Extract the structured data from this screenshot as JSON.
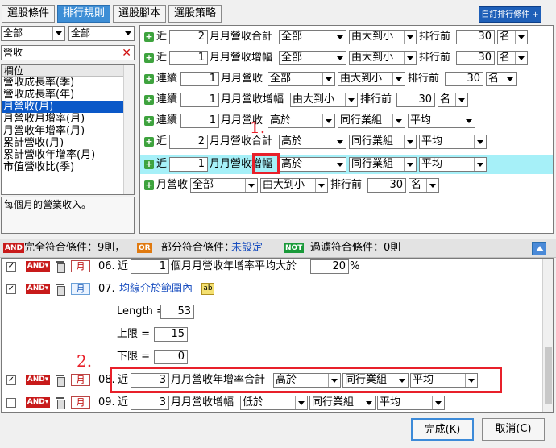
{
  "tabs": [
    {
      "label": "選股條件",
      "active": false
    },
    {
      "label": "排行規則",
      "active": true
    },
    {
      "label": "選股腳本",
      "active": false
    },
    {
      "label": "選股策略",
      "active": false
    }
  ],
  "custom_rank_button": "自訂排行條件",
  "left": {
    "combo1": "全部",
    "combo2": "全部",
    "search_value": "營收",
    "list_header": "欄位",
    "list_items": [
      "營收成長率(季)",
      "營收成長率(年)",
      "月營收(月)",
      "月營收月增率(月)",
      "月營收年增率(月)",
      "累計營收(月)",
      "累計營收年增率(月)",
      "市值營收比(季)"
    ],
    "selected_index": 2,
    "description": "每個月的營業收入。"
  },
  "rules": [
    {
      "prefix": "近",
      "num": "2",
      "field": "月月營收合計",
      "scope": "全部",
      "order": "由大到小",
      "rank_label": "排行前",
      "rank": "30",
      "unit": "名"
    },
    {
      "prefix": "近",
      "num": "1",
      "field": "月月營收增幅",
      "scope": "全部",
      "order": "由大到小",
      "rank_label": "排行前",
      "rank": "30",
      "unit": "名"
    },
    {
      "prefix": "連續",
      "num": "1",
      "field": "月月營收",
      "scope": "全部",
      "order": "由大到小",
      "rank_label": "排行前",
      "rank": "30",
      "unit": "名"
    },
    {
      "prefix": "連續",
      "num": "1",
      "field": "月月營收增幅",
      "scope": "由大到小",
      "order": "排行前",
      "rank": "30",
      "unit": "名"
    },
    {
      "prefix": "連續",
      "num": "1",
      "field": "月月營收",
      "cmp": "高於",
      "group": "同行業組",
      "stat": "平均"
    },
    {
      "prefix": "近",
      "num": "2",
      "field": "月月營收合計",
      "cmp": "高於",
      "group": "同行業組",
      "stat": "平均"
    },
    {
      "prefix": "近",
      "num": "1",
      "field": "月月營收增幅",
      "cmp": "高於",
      "group": "同行業組",
      "stat": "平均"
    },
    {
      "prefix": "月營收",
      "scope": "全部",
      "order": "由大到小",
      "rank_label": "排行前",
      "rank": "30",
      "unit": "名"
    }
  ],
  "annotations": {
    "one": "1.",
    "two": "2."
  },
  "midbar": {
    "and_badge": "AND",
    "full_match": "完全符合條件：9則，",
    "or_badge": "OR",
    "partial_label": "部分符合條件：",
    "partial_value": "未設定",
    "not_badge": "NOT",
    "filter_match": "過濾符合條件：0則"
  },
  "conditions": [
    {
      "checked": true,
      "and": "AND",
      "month": "月",
      "index": "06.",
      "text": "近",
      "num": "1",
      "field": "個月月營收年增率平均大於",
      "value": "20",
      "unit": "%"
    },
    {
      "checked": true,
      "and": "AND",
      "month": "月",
      "index": "07.",
      "text": "均線介於範圍內",
      "length_label": "Length =",
      "length": "53",
      "upper_label": "上限 =",
      "upper": "15",
      "lower_label": "下限 =",
      "lower": "0"
    },
    {
      "checked": true,
      "and": "AND",
      "month": "月",
      "index": "08.",
      "text": "近",
      "num": "3",
      "field": "月月營收年增率合計",
      "cmp": "高於",
      "group": "同行業組",
      "stat": "平均"
    },
    {
      "checked": false,
      "and": "AND",
      "month": "月",
      "index": "09.",
      "text": "近",
      "num": "3",
      "field": "月月營收增幅",
      "cmp": "低於",
      "group": "同行業組",
      "stat": "平均"
    }
  ],
  "buttons": {
    "ok": "完成(K)",
    "cancel": "取消(C)"
  }
}
